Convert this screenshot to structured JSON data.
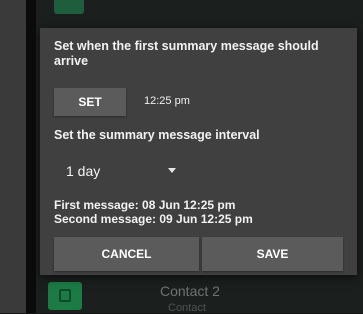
{
  "background": {
    "contact_name": "Contact 2",
    "contact_sub": "Contact"
  },
  "dialog": {
    "title": "Set when the first summary message should arrive",
    "set_button_label": "SET",
    "time_value": "12:25 pm",
    "interval_title": "Set the summary message interval",
    "interval_value": "1 day",
    "first_message": "First message: 08 Jun 12:25 pm",
    "second_message": "Second message: 09 Jun 12:25 pm",
    "cancel_label": "CANCEL",
    "save_label": "SAVE"
  },
  "colors": {
    "dialog_bg": "#404040",
    "button_bg": "#5b5b5b",
    "avatar_green": "#1c7a45"
  },
  "icons": {
    "dropdown": "chevron-down-icon",
    "avatar": "contact-avatar-icon"
  }
}
